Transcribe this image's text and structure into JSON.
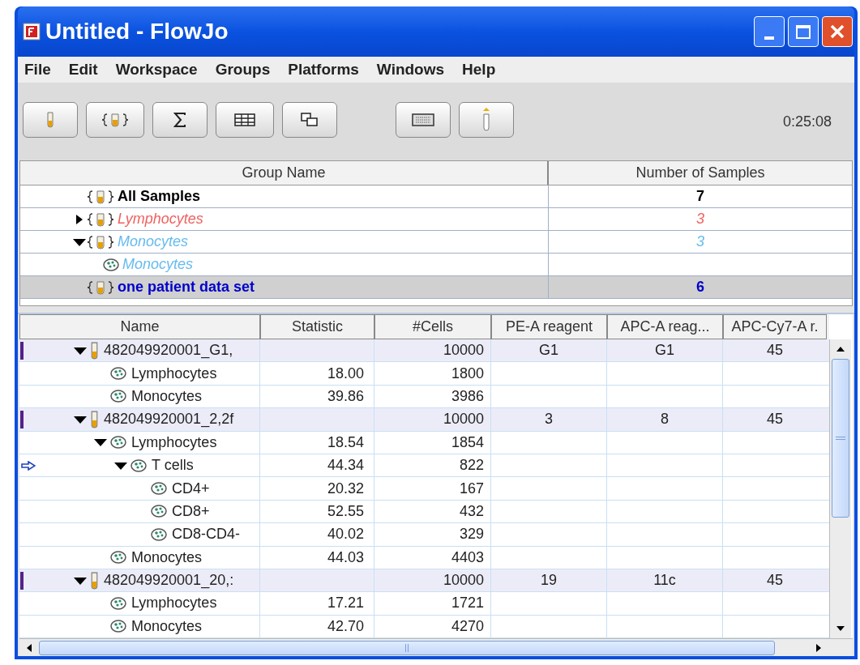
{
  "window": {
    "title": "Untitled - FlowJo"
  },
  "menu": [
    "File",
    "Edit",
    "Workspace",
    "Groups",
    "Platforms",
    "Windows",
    "Help"
  ],
  "toolbar": {
    "buttons": [
      {
        "kind": "tube"
      },
      {
        "kind": "group"
      },
      {
        "kind": "sum"
      },
      {
        "kind": "table"
      },
      {
        "kind": "layout"
      },
      {
        "kind": "keyboard"
      },
      {
        "kind": "add-tube"
      }
    ],
    "timer": "0:25:08"
  },
  "groups": {
    "columns": [
      "Group Name",
      "Number of Samples"
    ],
    "rows": [
      {
        "kind": "group",
        "name": "All Samples",
        "count": "7",
        "color": "#000000",
        "italic": false,
        "selected": false
      },
      {
        "kind": "group",
        "name": "Lymphocytes",
        "count": "3",
        "color": "#f06060",
        "italic": true,
        "selected": false,
        "expanded": false
      },
      {
        "kind": "group",
        "name": "Monocytes",
        "count": "3",
        "color": "#66bbee",
        "italic": true,
        "selected": false,
        "expanded": true,
        "children": [
          {
            "kind": "gate",
            "name": "Monocytes",
            "color": "#66bbee",
            "italic": true,
            "selected": false
          }
        ]
      },
      {
        "kind": "group",
        "name": "one patient data set",
        "count": "6",
        "color": "#0000cc",
        "italic": false,
        "selected": true
      }
    ]
  },
  "samples": {
    "columns": [
      "Name",
      "Statistic",
      "#Cells",
      "PE-A reagent",
      "APC-A reag...",
      "APC-Cy7-A r."
    ],
    "rows": [
      {
        "kind": "sample",
        "name": "482049920001_G1,",
        "cells": "10000",
        "pe": "G1",
        "apc": "G1",
        "apc_cy7": "45",
        "expanded": true,
        "children": [
          {
            "kind": "gate",
            "name": "Lymphocytes",
            "statistic": "18.00",
            "cells": "1800"
          },
          {
            "kind": "gate",
            "name": "Monocytes",
            "statistic": "39.86",
            "cells": "3986"
          }
        ]
      },
      {
        "kind": "sample",
        "name": "482049920001_2,2f",
        "cells": "10000",
        "pe": "3",
        "apc": "8",
        "apc_cy7": "45",
        "expanded": true,
        "children": [
          {
            "kind": "gate",
            "name": "Lymphocytes",
            "statistic": "18.54",
            "cells": "1854",
            "expanded": true,
            "children": [
              {
                "kind": "gate",
                "name": "T cells",
                "statistic": "44.34",
                "cells": "822",
                "expanded": true,
                "current": true,
                "children": [
                  {
                    "kind": "gate",
                    "name": "CD4+",
                    "statistic": "20.32",
                    "cells": "167"
                  },
                  {
                    "kind": "gate",
                    "name": "CD8+",
                    "statistic": "52.55",
                    "cells": "432"
                  },
                  {
                    "kind": "gate",
                    "name": "CD8-CD4-",
                    "statistic": "40.02",
                    "cells": "329"
                  }
                ]
              }
            ]
          },
          {
            "kind": "gate",
            "name": "Monocytes",
            "statistic": "44.03",
            "cells": "4403"
          }
        ]
      },
      {
        "kind": "sample",
        "name": "482049920001_20,:",
        "cells": "10000",
        "pe": "19",
        "apc": "11c",
        "apc_cy7": "45",
        "expanded": true,
        "children": [
          {
            "kind": "gate",
            "name": "Lymphocytes",
            "statistic": "17.21",
            "cells": "1721"
          },
          {
            "kind": "gate",
            "name": "Monocytes",
            "statistic": "42.70",
            "cells": "4270"
          }
        ]
      }
    ]
  }
}
